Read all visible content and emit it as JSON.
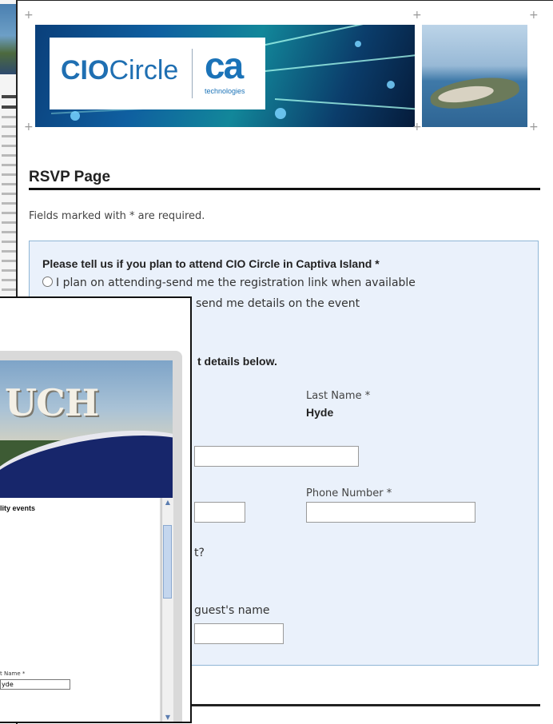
{
  "back_window": {},
  "header": {
    "logo_cio_bold": "CIO",
    "logo_cio_rest": "Circle",
    "logo_ca": "ca",
    "logo_ca_sub": "technologies"
  },
  "page": {
    "title": "RSVP Page",
    "required_note": "Fields marked with * are required."
  },
  "form": {
    "attend_question": "Please tell us if you plan to attend CIO Circle in Captiva Island *",
    "option_attend": "I plan on attending-send me the registration link when available",
    "option_details_tail": "send me details on the event",
    "contact_tail": "t details below.",
    "last_name_label": "Last Name *",
    "last_name_value": "Hyde",
    "phone_label": "Phone Number *",
    "phone_value": "",
    "email_value": "",
    "first_name_value": "",
    "question_tail": "t?",
    "guest_label_tail": "guest's name",
    "guest_name_value": ""
  },
  "overlay": {
    "banner_letters": "UCH",
    "heading": "lity events",
    "last_name_label": "t Name *",
    "last_name_value": "yde",
    "scroll_up": "▲",
    "scroll_down": "▼"
  }
}
